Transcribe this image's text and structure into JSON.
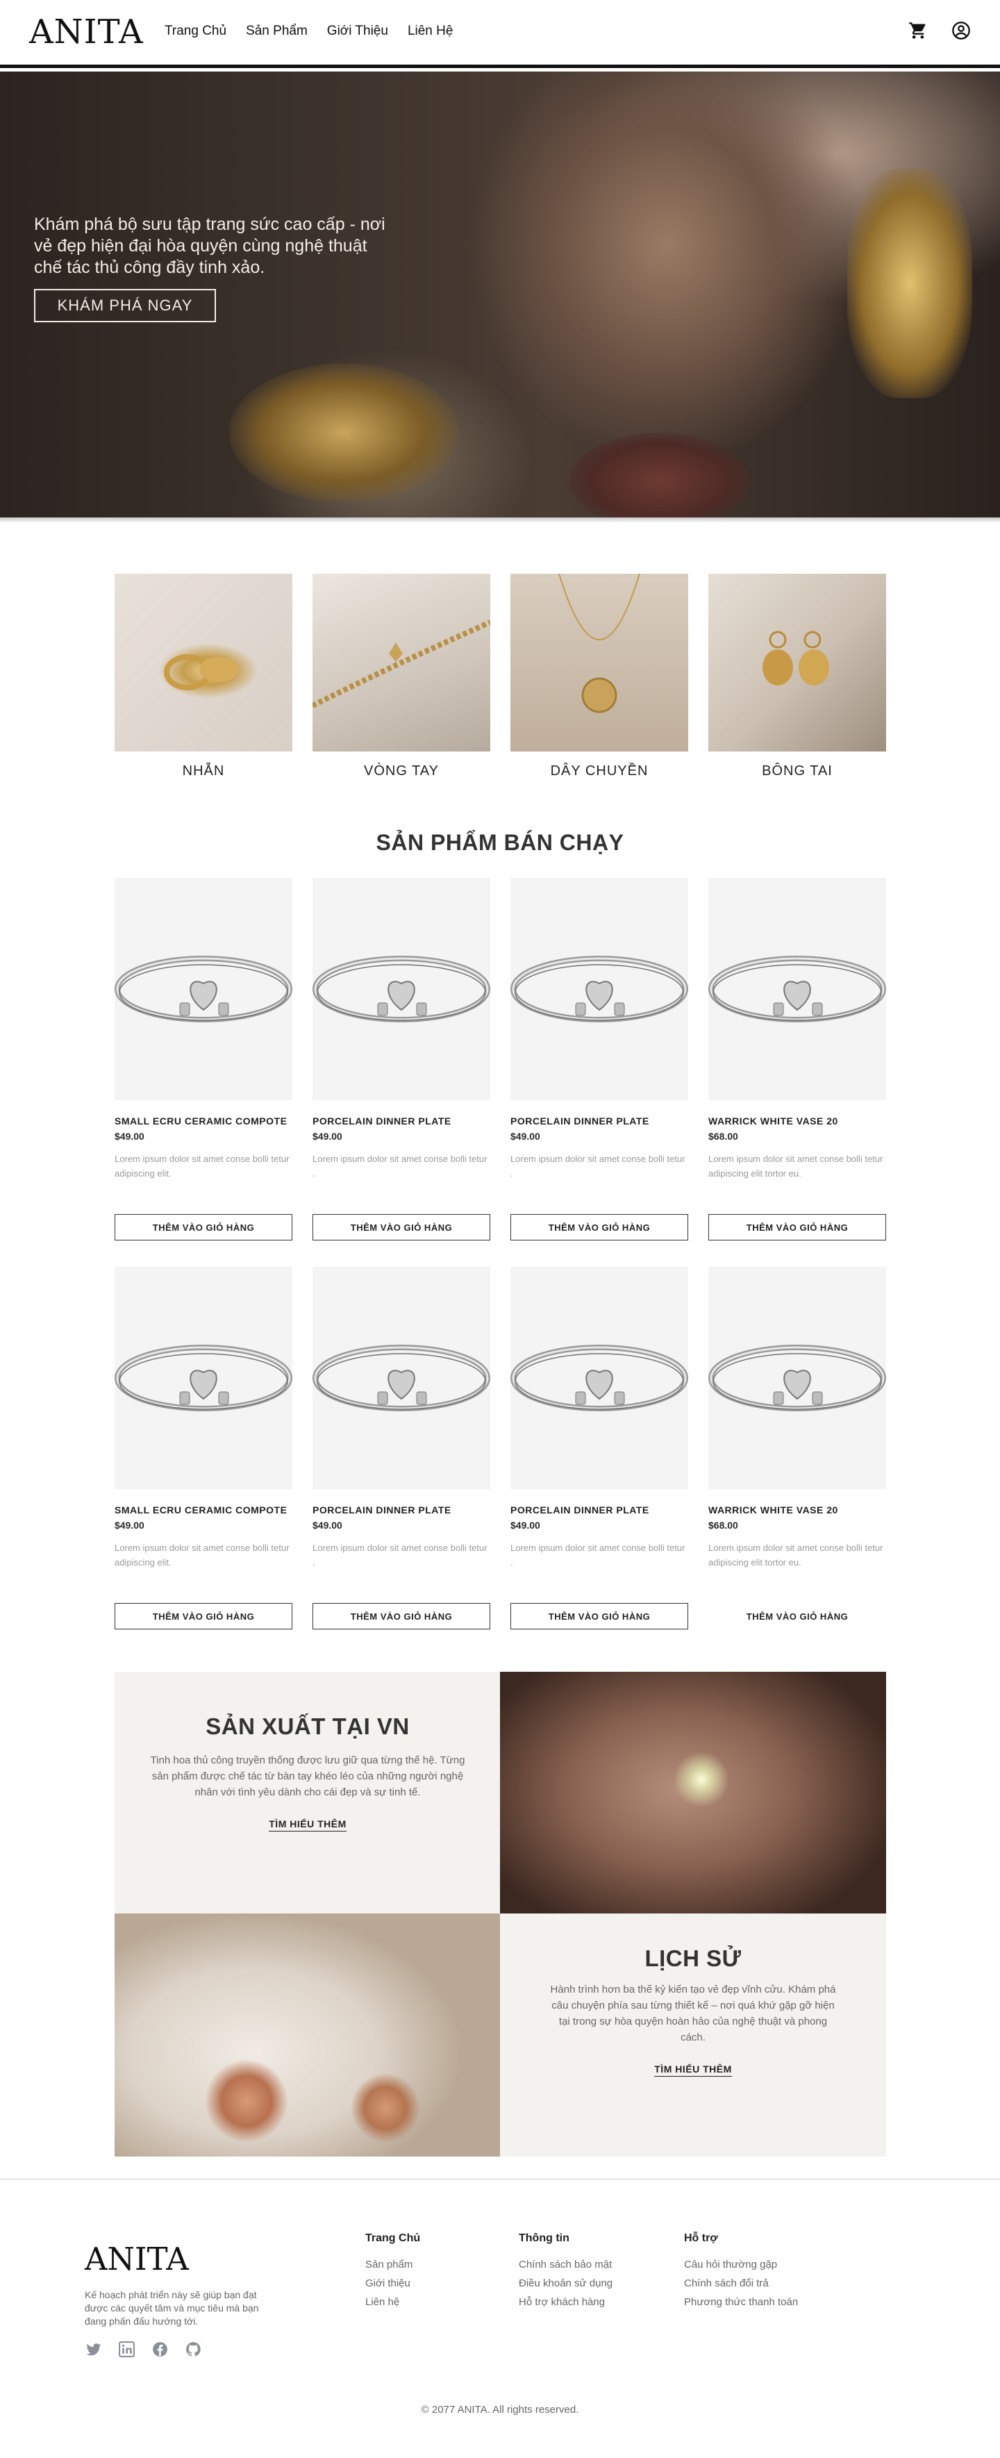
{
  "header": {
    "logo": "ANITA",
    "nav": [
      "Trang Chủ",
      "Sản Phẩm",
      "Giới Thiệu",
      "Liên Hệ"
    ],
    "icons": [
      "cart-icon",
      "user-icon"
    ]
  },
  "hero": {
    "text": "Khám phá bộ sưu tập trang sức cao cấp - nơi vẻ đẹp hiện đại hòa quyện cùng nghệ thuật chế tác thủ công đầy tinh xảo.",
    "button": "KHÁM PHÁ NGAY"
  },
  "categories": [
    "NHẪN",
    "VÒNG TAY",
    "DÂY CHUYỀN",
    "BÔNG TAI"
  ],
  "bestsellers": {
    "title": "SẢN PHẨM BÁN CHẠY",
    "products": [
      {
        "name": "SMALL ECRU CERAMIC COMPOTE",
        "price": "$49.00",
        "desc": "Lorem ipsum dolor sit amet conse bolli tetur adipiscing elit.",
        "button": "THÊM VÀO GIỎ HÀNG"
      },
      {
        "name": "PORCELAIN DINNER PLATE",
        "price": "$49.00",
        "desc": "Lorem ipsum dolor sit amet conse bolli tetur .",
        "button": "THÊM VÀO GIỎ HÀNG"
      },
      {
        "name": "PORCELAIN DINNER PLATE",
        "price": "$49.00",
        "desc": "Lorem ipsum dolor sit amet conse bolli tetur .",
        "button": "THÊM VÀO GIỎ HÀNG"
      },
      {
        "name": "WARRICK WHITE VASE 20",
        "price": "$68.00",
        "desc": "Lorem ipsum dolor sit amet conse bolli tetur adipiscing elit tortor eu.",
        "button": "THÊM VÀO GIỎ HÀNG"
      },
      {
        "name": "SMALL ECRU CERAMIC COMPOTE",
        "price": "$49.00",
        "desc": "Lorem ipsum dolor sit amet conse bolli tetur adipiscing elit.",
        "button": "THÊM VÀO GIỎ HÀNG"
      },
      {
        "name": "PORCELAIN DINNER PLATE",
        "price": "$49.00",
        "desc": "Lorem ipsum dolor sit amet conse bolli tetur .",
        "button": "THÊM VÀO GIỎ HÀNG"
      },
      {
        "name": "PORCELAIN DINNER PLATE",
        "price": "$49.00",
        "desc": "Lorem ipsum dolor sit amet conse bolli tetur .",
        "button": "THÊM VÀO GIỎ HÀNG"
      },
      {
        "name": "WARRICK WHITE VASE 20",
        "price": "$68.00",
        "desc": "Lorem ipsum dolor sit amet conse bolli tetur adipiscing elit tortor eu.",
        "button": "THÊM VÀO GIỎ HÀNG"
      }
    ]
  },
  "story": {
    "made": {
      "title": "SẢN XUẤT TẠI VN",
      "text": "Tinh hoa thủ công truyền thống được lưu giữ qua từng thế hệ. Từng sản phẩm được chế tác từ bàn tay khéo léo của những người nghệ nhân với tình yêu dành cho cái đẹp và sự tinh tế.",
      "link": "TÌM HIỂU THÊM"
    },
    "history": {
      "title": "LỊCH SỬ",
      "text": "Hành trình hơn ba thế kỷ kiến tạo vẻ đẹp vĩnh cửu. Khám phá câu chuyện phía sau từng thiết kế – nơi quá khứ gặp gỡ hiện tại trong sự hòa quyện hoàn hảo của nghệ thuật và phong cách.",
      "link": "TÌM HIỂU THÊM"
    }
  },
  "footer": {
    "logo": "ANITA",
    "desc": "Kế hoạch phát triển này sẽ giúp bạn đạt được các quyết tâm và mục tiêu mà bạn đang phấn đấu hướng tới.",
    "social": [
      "twitter-icon",
      "linkedin-icon",
      "facebook-icon",
      "github-icon"
    ],
    "columns": [
      {
        "heading": "Trang Chủ",
        "items": [
          "Sản phẩm",
          "Giới thiệu",
          "Liên hệ"
        ]
      },
      {
        "heading": "Thông tin",
        "items": [
          "Chính sách bảo mật",
          "Điều khoản sử dụng",
          "Hỗ trợ khách hàng"
        ]
      },
      {
        "heading": "Hỗ trợ",
        "items": [
          "Câu hỏi thường gặp",
          "Chính sách đổi trả",
          "Phương thức thanh toán"
        ]
      }
    ],
    "copyright": "© 2077 ANITA. All rights reserved."
  },
  "colors": {
    "dark": "#111111",
    "muted": "#9a9a9a",
    "panel": "#f4f2ef",
    "product_bg": "#f4f4f4"
  }
}
